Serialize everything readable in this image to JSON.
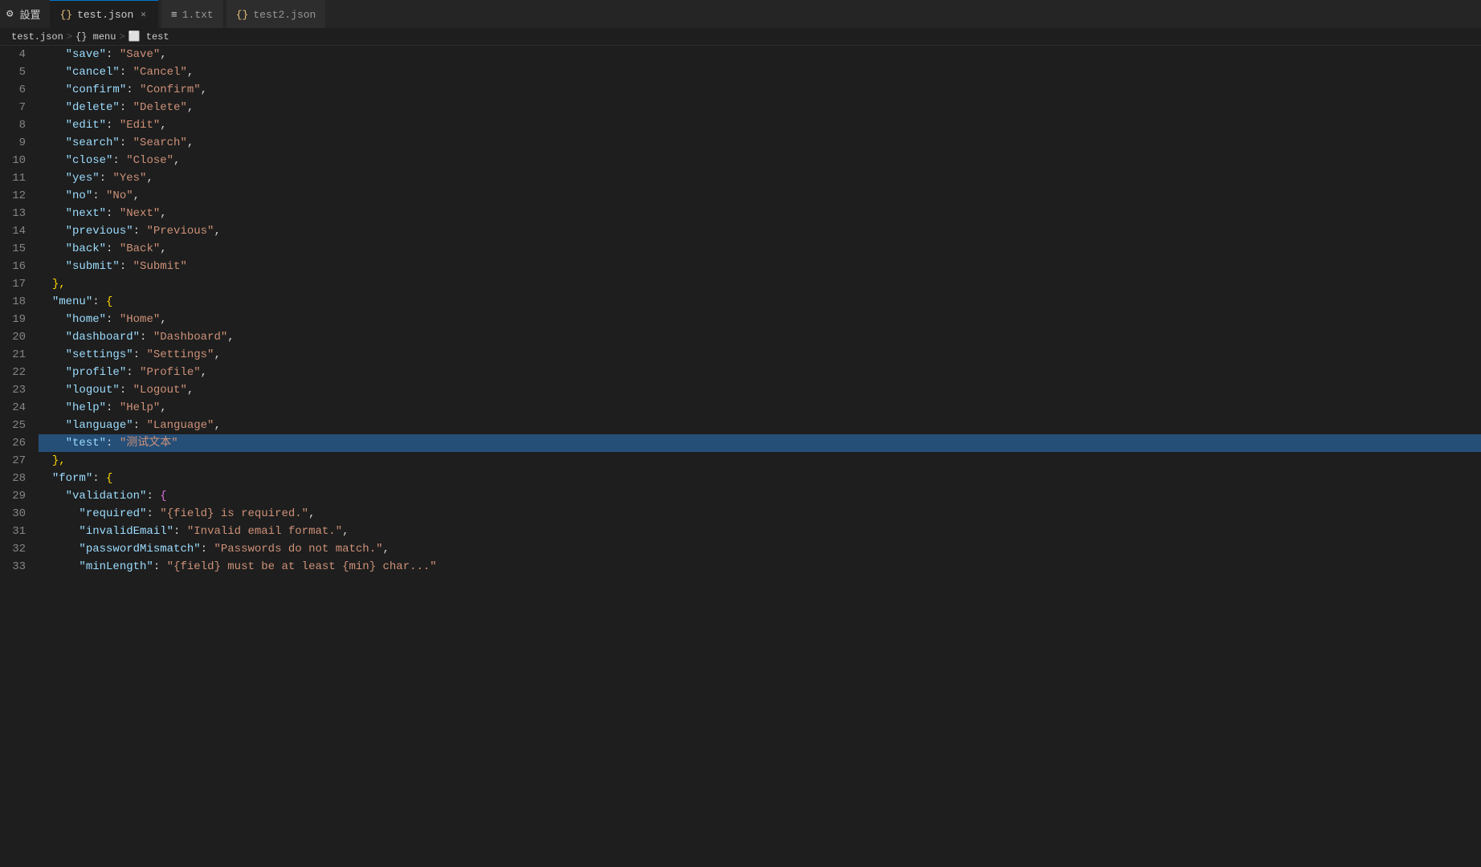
{
  "titlebar": {
    "icon_label": "⚙",
    "settings_tab_label": "設置",
    "tabs": [
      {
        "id": "test-json",
        "label": "test.json",
        "icon": "{}",
        "active": true,
        "closeable": true
      },
      {
        "id": "1-txt",
        "label": "1.txt",
        "icon": "≡",
        "active": false,
        "closeable": false
      },
      {
        "id": "test2-json",
        "label": "test2.json",
        "icon": "{}",
        "active": false,
        "closeable": false
      }
    ]
  },
  "breadcrumb": {
    "items": [
      "test.json",
      "{} menu",
      "⬜ test"
    ]
  },
  "lines": [
    {
      "num": 4,
      "tokens": [
        {
          "t": "indent",
          "v": "    "
        },
        {
          "t": "key",
          "v": "\"save\""
        },
        {
          "t": "punc",
          "v": ": "
        },
        {
          "t": "str",
          "v": "\"Save\""
        },
        {
          "t": "punc",
          "v": ","
        }
      ]
    },
    {
      "num": 5,
      "tokens": [
        {
          "t": "indent",
          "v": "    "
        },
        {
          "t": "key",
          "v": "\"cancel\""
        },
        {
          "t": "punc",
          "v": ": "
        },
        {
          "t": "str",
          "v": "\"Cancel\""
        },
        {
          "t": "punc",
          "v": ","
        }
      ]
    },
    {
      "num": 6,
      "tokens": [
        {
          "t": "indent",
          "v": "    "
        },
        {
          "t": "key",
          "v": "\"confirm\""
        },
        {
          "t": "punc",
          "v": ": "
        },
        {
          "t": "str",
          "v": "\"Confirm\""
        },
        {
          "t": "punc",
          "v": ","
        }
      ]
    },
    {
      "num": 7,
      "tokens": [
        {
          "t": "indent",
          "v": "    "
        },
        {
          "t": "key",
          "v": "\"delete\""
        },
        {
          "t": "punc",
          "v": ": "
        },
        {
          "t": "str",
          "v": "\"Delete\""
        },
        {
          "t": "punc",
          "v": ","
        }
      ]
    },
    {
      "num": 8,
      "tokens": [
        {
          "t": "indent",
          "v": "    "
        },
        {
          "t": "key",
          "v": "\"edit\""
        },
        {
          "t": "punc",
          "v": ": "
        },
        {
          "t": "str",
          "v": "\"Edit\""
        },
        {
          "t": "punc",
          "v": ","
        }
      ]
    },
    {
      "num": 9,
      "tokens": [
        {
          "t": "indent",
          "v": "    "
        },
        {
          "t": "key",
          "v": "\"search\""
        },
        {
          "t": "punc",
          "v": ": "
        },
        {
          "t": "str",
          "v": "\"Search\""
        },
        {
          "t": "punc",
          "v": ","
        }
      ]
    },
    {
      "num": 10,
      "tokens": [
        {
          "t": "indent",
          "v": "    "
        },
        {
          "t": "key",
          "v": "\"close\""
        },
        {
          "t": "punc",
          "v": ": "
        },
        {
          "t": "str",
          "v": "\"Close\""
        },
        {
          "t": "punc",
          "v": ","
        }
      ]
    },
    {
      "num": 11,
      "tokens": [
        {
          "t": "indent",
          "v": "    "
        },
        {
          "t": "key",
          "v": "\"yes\""
        },
        {
          "t": "punc",
          "v": ": "
        },
        {
          "t": "str",
          "v": "\"Yes\""
        },
        {
          "t": "punc",
          "v": ","
        }
      ]
    },
    {
      "num": 12,
      "tokens": [
        {
          "t": "indent",
          "v": "    "
        },
        {
          "t": "key",
          "v": "\"no\""
        },
        {
          "t": "punc",
          "v": ": "
        },
        {
          "t": "str",
          "v": "\"No\""
        },
        {
          "t": "punc",
          "v": ","
        }
      ]
    },
    {
      "num": 13,
      "tokens": [
        {
          "t": "indent",
          "v": "    "
        },
        {
          "t": "key",
          "v": "\"next\""
        },
        {
          "t": "punc",
          "v": ": "
        },
        {
          "t": "str",
          "v": "\"Next\""
        },
        {
          "t": "punc",
          "v": ","
        }
      ]
    },
    {
      "num": 14,
      "tokens": [
        {
          "t": "indent",
          "v": "    "
        },
        {
          "t": "key",
          "v": "\"previous\""
        },
        {
          "t": "punc",
          "v": ": "
        },
        {
          "t": "str",
          "v": "\"Previous\""
        },
        {
          "t": "punc",
          "v": ","
        }
      ]
    },
    {
      "num": 15,
      "tokens": [
        {
          "t": "indent",
          "v": "    "
        },
        {
          "t": "key",
          "v": "\"back\""
        },
        {
          "t": "punc",
          "v": ": "
        },
        {
          "t": "str",
          "v": "\"Back\""
        },
        {
          "t": "punc",
          "v": ","
        }
      ]
    },
    {
      "num": 16,
      "tokens": [
        {
          "t": "indent",
          "v": "    "
        },
        {
          "t": "key",
          "v": "\"submit\""
        },
        {
          "t": "punc",
          "v": ": "
        },
        {
          "t": "str",
          "v": "\"Submit\""
        }
      ]
    },
    {
      "num": 17,
      "tokens": [
        {
          "t": "indent",
          "v": "  "
        },
        {
          "t": "brace",
          "v": "},"
        }
      ]
    },
    {
      "num": 18,
      "tokens": [
        {
          "t": "indent",
          "v": "  "
        },
        {
          "t": "key",
          "v": "\"menu\""
        },
        {
          "t": "punc",
          "v": ": "
        },
        {
          "t": "brace",
          "v": "{"
        }
      ]
    },
    {
      "num": 19,
      "tokens": [
        {
          "t": "indent",
          "v": "    "
        },
        {
          "t": "key",
          "v": "\"home\""
        },
        {
          "t": "punc",
          "v": ": "
        },
        {
          "t": "str",
          "v": "\"Home\""
        },
        {
          "t": "punc",
          "v": ","
        }
      ]
    },
    {
      "num": 20,
      "tokens": [
        {
          "t": "indent",
          "v": "    "
        },
        {
          "t": "key",
          "v": "\"dashboard\""
        },
        {
          "t": "punc",
          "v": ": "
        },
        {
          "t": "str",
          "v": "\"Dashboard\""
        },
        {
          "t": "punc",
          "v": ","
        }
      ]
    },
    {
      "num": 21,
      "tokens": [
        {
          "t": "indent",
          "v": "    "
        },
        {
          "t": "key",
          "v": "\"settings\""
        },
        {
          "t": "punc",
          "v": ": "
        },
        {
          "t": "str",
          "v": "\"Settings\""
        },
        {
          "t": "punc",
          "v": ","
        }
      ]
    },
    {
      "num": 22,
      "tokens": [
        {
          "t": "indent",
          "v": "    "
        },
        {
          "t": "key",
          "v": "\"profile\""
        },
        {
          "t": "punc",
          "v": ": "
        },
        {
          "t": "str",
          "v": "\"Profile\""
        },
        {
          "t": "punc",
          "v": ","
        }
      ]
    },
    {
      "num": 23,
      "tokens": [
        {
          "t": "indent",
          "v": "    "
        },
        {
          "t": "key",
          "v": "\"logout\""
        },
        {
          "t": "punc",
          "v": ": "
        },
        {
          "t": "str",
          "v": "\"Logout\""
        },
        {
          "t": "punc",
          "v": ","
        }
      ]
    },
    {
      "num": 24,
      "tokens": [
        {
          "t": "indent",
          "v": "    "
        },
        {
          "t": "key",
          "v": "\"help\""
        },
        {
          "t": "punc",
          "v": ": "
        },
        {
          "t": "str",
          "v": "\"Help\""
        },
        {
          "t": "punc",
          "v": ","
        }
      ]
    },
    {
      "num": 25,
      "tokens": [
        {
          "t": "indent",
          "v": "    "
        },
        {
          "t": "key",
          "v": "\"language\""
        },
        {
          "t": "punc",
          "v": ": "
        },
        {
          "t": "str",
          "v": "\"Language\""
        },
        {
          "t": "punc",
          "v": ","
        }
      ]
    },
    {
      "num": 26,
      "tokens": [
        {
          "t": "indent",
          "v": "    "
        },
        {
          "t": "key",
          "v": "\"test\""
        },
        {
          "t": "punc",
          "v": ": "
        },
        {
          "t": "str",
          "v": "\"测试文本\""
        }
      ],
      "highlighted": true
    },
    {
      "num": 27,
      "tokens": [
        {
          "t": "indent",
          "v": "  "
        },
        {
          "t": "brace",
          "v": "},"
        }
      ]
    },
    {
      "num": 28,
      "tokens": [
        {
          "t": "indent",
          "v": "  "
        },
        {
          "t": "key",
          "v": "\"form\""
        },
        {
          "t": "punc",
          "v": ": "
        },
        {
          "t": "brace",
          "v": "{"
        }
      ]
    },
    {
      "num": 29,
      "tokens": [
        {
          "t": "indent",
          "v": "    "
        },
        {
          "t": "key",
          "v": "\"validation\""
        },
        {
          "t": "punc",
          "v": ": "
        },
        {
          "t": "brace2",
          "v": "{"
        }
      ]
    },
    {
      "num": 30,
      "tokens": [
        {
          "t": "indent",
          "v": "      "
        },
        {
          "t": "key",
          "v": "\"required\""
        },
        {
          "t": "punc",
          "v": ": "
        },
        {
          "t": "str",
          "v": "\"{field} is required.\""
        },
        {
          "t": "punc",
          "v": ","
        }
      ]
    },
    {
      "num": 31,
      "tokens": [
        {
          "t": "indent",
          "v": "      "
        },
        {
          "t": "key",
          "v": "\"invalidEmail\""
        },
        {
          "t": "punc",
          "v": ": "
        },
        {
          "t": "str",
          "v": "\"Invalid email format.\""
        },
        {
          "t": "punc",
          "v": ","
        }
      ]
    },
    {
      "num": 32,
      "tokens": [
        {
          "t": "indent",
          "v": "      "
        },
        {
          "t": "key",
          "v": "\"passwordMismatch\""
        },
        {
          "t": "punc",
          "v": ": "
        },
        {
          "t": "str",
          "v": "\"Passwords do not match.\""
        },
        {
          "t": "punc",
          "v": ","
        }
      ]
    },
    {
      "num": 33,
      "tokens": [
        {
          "t": "indent",
          "v": "      "
        },
        {
          "t": "key",
          "v": "\"minLength\""
        },
        {
          "t": "punc",
          "v": ": "
        },
        {
          "t": "str",
          "v": "\"{field} must be at least {min} char...\""
        }
      ]
    }
  ]
}
